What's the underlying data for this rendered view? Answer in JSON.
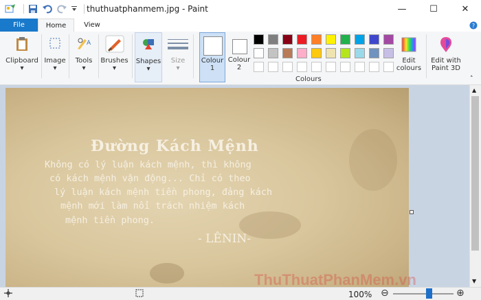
{
  "window": {
    "title": "thuthuatphanmem.jpg - Paint",
    "minimize": "—",
    "maximize": "☐",
    "close": "✕"
  },
  "tabs": {
    "file": "File",
    "home": "Home",
    "view": "View"
  },
  "ribbon": {
    "clipboard": "Clipboard",
    "image": "Image",
    "tools": "Tools",
    "brushes": "Brushes",
    "shapes": "Shapes",
    "size": "Size",
    "colour1_a": "Colour",
    "colour1_b": "1",
    "colour2_a": "Colour",
    "colour2_b": "2",
    "edit_colours_a": "Edit",
    "edit_colours_b": "colours",
    "paint3d_a": "Edit with",
    "paint3d_b": "Paint 3D",
    "colours_group": "Colours"
  },
  "palette": {
    "row1": [
      "#000000",
      "#7f7f7f",
      "#880015",
      "#ed1c24",
      "#ff7f27",
      "#fff200",
      "#22b14c",
      "#00a2e8",
      "#3f48cc",
      "#a349a4"
    ],
    "row2": [
      "#ffffff",
      "#c3c3c3",
      "#b97a57",
      "#ffaec9",
      "#ffc90e",
      "#efe4b0",
      "#b5e61d",
      "#99d9ea",
      "#7092be",
      "#c8bfe7"
    ],
    "colour1": "#ffffff",
    "colour2": "#ffffff"
  },
  "picture": {
    "heading": "Đường Kách Mệnh",
    "lines": [
      "Không có lý luận kách mệnh, thì không",
      "có kách mệnh vận động... Chỉ có theo",
      "lý luận kách mệnh tiền phong, đảng kách",
      "mệnh mới làm nổi trách nhiệm kách",
      "mệnh tiền phong."
    ],
    "author": "- LÊNIN-"
  },
  "status": {
    "zoom": "100%",
    "zoom_fraction": 0.5
  },
  "watermark": "ThuThuatPhanMem.vn"
}
